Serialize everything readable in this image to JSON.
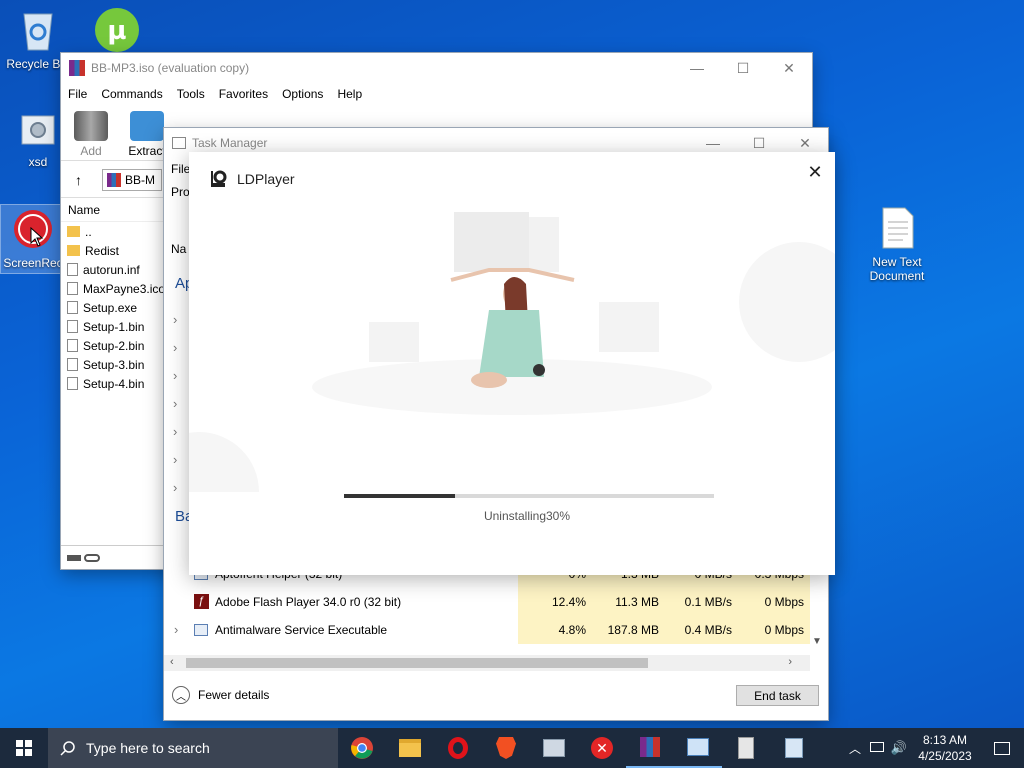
{
  "desktop": {
    "icons": [
      {
        "label": "Recycle Bin"
      },
      {
        "label": "xsd"
      },
      {
        "label": "ScreenRec"
      },
      {
        "label": "New Text Document"
      }
    ]
  },
  "winrar": {
    "title": "BB-MP3.iso (evaluation copy)",
    "menu": [
      "File",
      "Commands",
      "Tools",
      "Favorites",
      "Options",
      "Help"
    ],
    "toolbar": [
      "Add",
      "Extract"
    ],
    "path": "BB-M",
    "column_name": "Name",
    "files": [
      "..",
      "Redist",
      "autorun.inf",
      "MaxPayne3.ico",
      "Setup.exe",
      "Setup-1.bin",
      "Setup-2.bin",
      "Setup-3.bin",
      "Setup-4.bin"
    ]
  },
  "taskmgr": {
    "title": "Task Manager",
    "menu_file": "File",
    "tab_processes": "Pro",
    "col_name": "Na",
    "section_apps": "Ap",
    "section_background": "Ba",
    "rows": [
      {
        "name": "Aptoffent Helper (32 bit)",
        "cpu": "0%",
        "mem": "1.3 MB",
        "disk": "0 MB/s",
        "net": "0.3 Mbps"
      },
      {
        "name": "Adobe Flash Player 34.0 r0 (32 bit)",
        "cpu": "12.4%",
        "mem": "11.3 MB",
        "disk": "0.1 MB/s",
        "net": "0 Mbps"
      },
      {
        "name": "Antimalware Service Executable",
        "cpu": "4.8%",
        "mem": "187.8 MB",
        "disk": "0.4 MB/s",
        "net": "0 Mbps"
      }
    ],
    "fewer_details": "Fewer details",
    "end_task": "End task"
  },
  "ldplayer": {
    "title": "LDPlayer",
    "status": "Uninstalling30%",
    "progress": 0.3
  },
  "taskbar": {
    "search_placeholder": "Type here to search",
    "time": "8:13 AM",
    "date": "4/25/2023"
  },
  "colors": {
    "accent": "#0078d7",
    "cpu_highlight": "#fdf3c4",
    "progress_fill": "#333333",
    "progress_track": "#d9d9d9"
  }
}
